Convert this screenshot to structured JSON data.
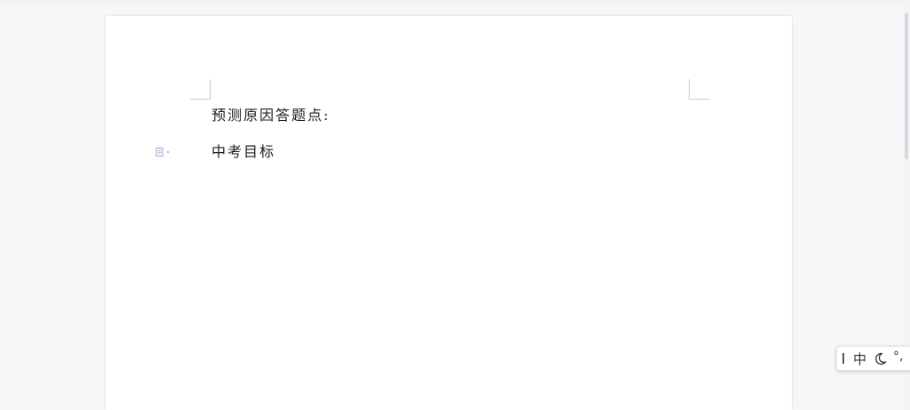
{
  "document": {
    "paragraphs": [
      {
        "text": "预测原因答题点:"
      },
      {
        "text": "中考目标"
      }
    ]
  },
  "ime_toolbar": {
    "language_label": "中",
    "mode_icon": "moon-icon",
    "punctuation_label": "°,"
  },
  "icons": {
    "paragraph_marker": "paragraph-handle-icon",
    "toolbar_grip": "grip-icon"
  }
}
